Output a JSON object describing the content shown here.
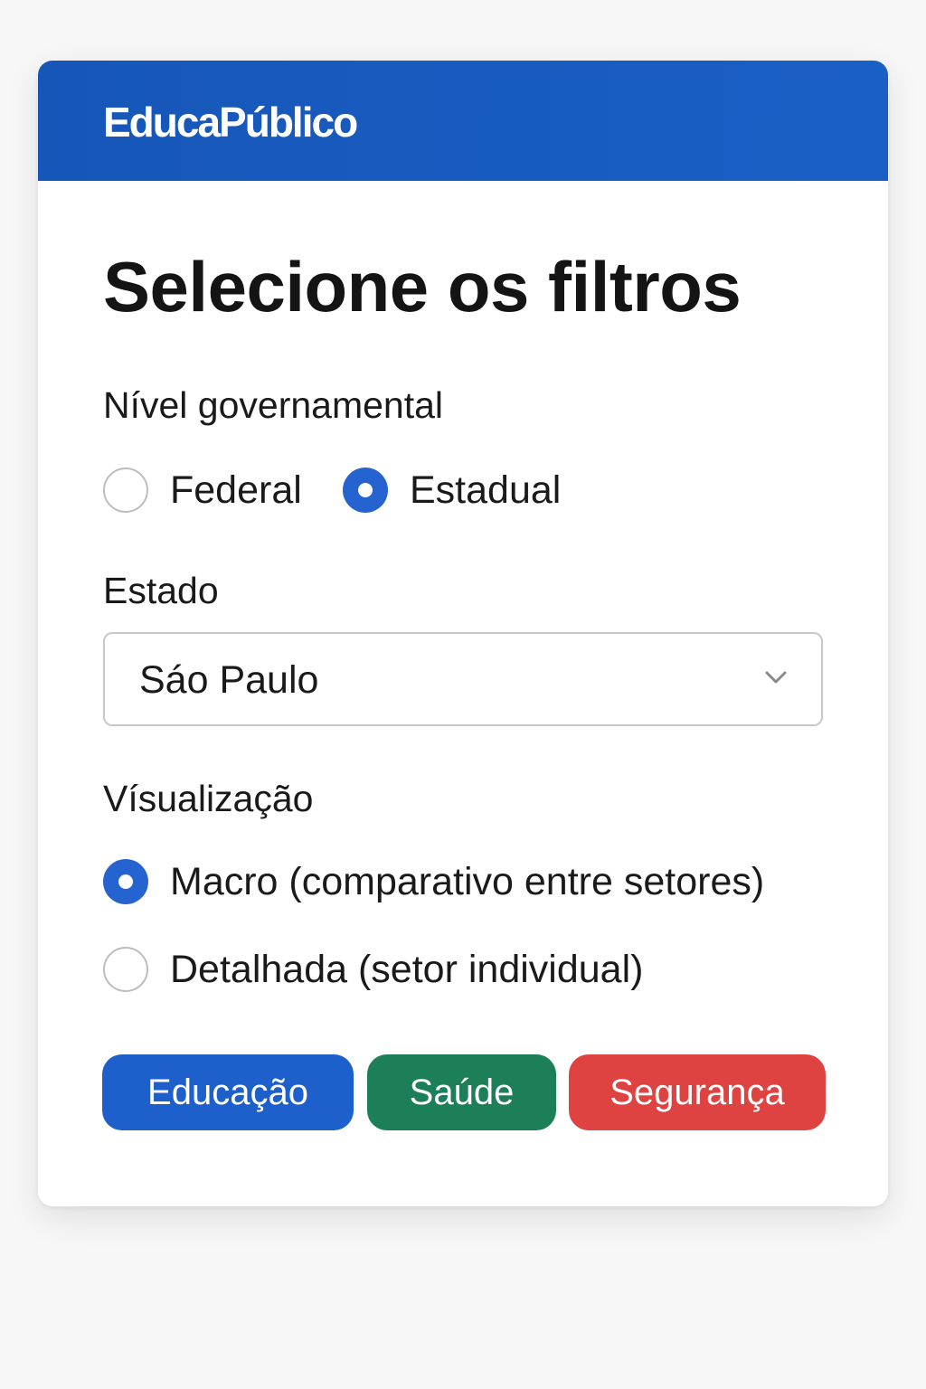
{
  "brand": {
    "name": "EducaPúblico"
  },
  "title": "Selecione os filtros",
  "nivel": {
    "label": "Nível governamental",
    "options": [
      {
        "label": "Federal",
        "checked": false
      },
      {
        "label": "Estadual",
        "checked": true
      }
    ]
  },
  "estado": {
    "label": "Estado",
    "selected": "Sáo Paulo",
    "icon": "chevron-down-icon"
  },
  "visualizacao": {
    "label": "Vísualização",
    "options": [
      {
        "label": "Macro (comparativo entre setores)",
        "checked": true
      },
      {
        "label": "Detalhada (setor individual)",
        "checked": false
      }
    ]
  },
  "sectors": [
    {
      "label": "Educação",
      "color": "#1d5fcb"
    },
    {
      "label": "Saúde",
      "color": "#1c7f58"
    },
    {
      "label": "Segurança",
      "color": "#de4341"
    }
  ],
  "colors": {
    "header": "#1a5bc2",
    "radio_checked": "#2563d0"
  }
}
